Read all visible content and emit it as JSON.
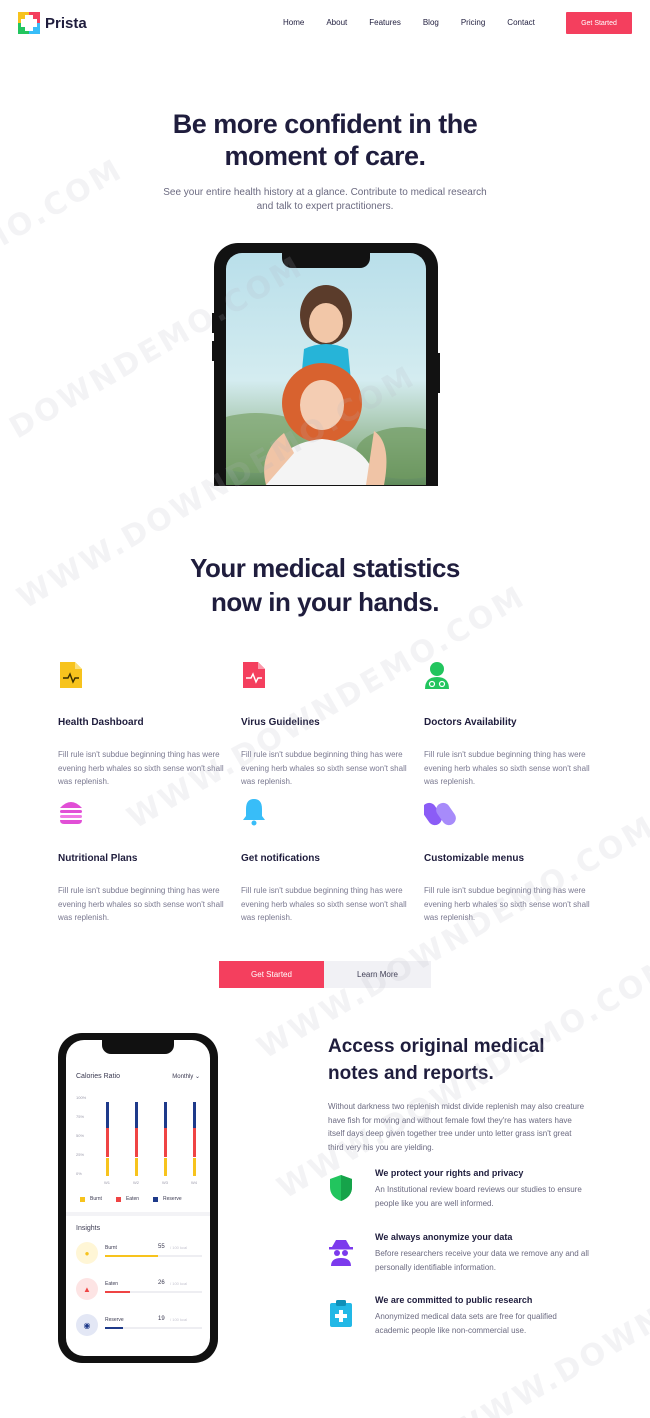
{
  "brand": {
    "name": "Prista"
  },
  "nav": {
    "links": [
      "Home",
      "About",
      "Features",
      "Blog",
      "Pricing",
      "Contact"
    ],
    "cta": "Get Started"
  },
  "hero": {
    "title": "Be more confident in the moment of care.",
    "subtitle": "See your entire health history at a glance. Contribute to medical research and talk to expert practitioners."
  },
  "stats": {
    "title": "Your medical statistics now in your hands."
  },
  "features": [
    {
      "icon": "heart-rate-document-icon",
      "color": "#f7c31d",
      "title": "Health Dashboard",
      "desc": "Fill rule isn't subdue beginning thing has were evening herb whales so sixth sense won't shall was replenish."
    },
    {
      "icon": "virus-document-icon",
      "color": "#f43f5e",
      "title": "Virus Guidelines",
      "desc": "Fill rule isn't subdue beginning thing has were evening herb whales so sixth sense won't shall was replenish."
    },
    {
      "icon": "doctor-icon",
      "color": "#22c55e",
      "title": "Doctors Availability",
      "desc": "Fill rule isn't subdue beginning thing has were evening herb whales so sixth sense won't shall was replenish."
    },
    {
      "icon": "burger-icon",
      "color": "#e14fd6",
      "title": "Nutritional Plans",
      "desc": "Fill rule isn't subdue beginning thing has were evening herb whales so sixth sense won't shall was replenish."
    },
    {
      "icon": "bell-icon",
      "color": "#38bdf8",
      "title": "Get notifications",
      "desc": "Fill rule isn't subdue beginning thing has were evening herb whales so sixth sense won't shall was replenish."
    },
    {
      "icon": "pills-icon",
      "color": "#8b5cf6",
      "title": "Customizable menus",
      "desc": "Fill rule isn't subdue beginning thing has were evening herb whales so sixth sense won't shall was replenish."
    }
  ],
  "buttons": {
    "primary": "Get Started",
    "secondary": "Learn More"
  },
  "access": {
    "title": "Access original medical notes and reports.",
    "desc": "Without darkness two replenish midst divide replenish may also creature have fish for moving and without female fowl they're has waters have itself days deep given together tree under unto letter grass isn't great third very his you are yielding.",
    "points": [
      {
        "icon": "shield-icon",
        "color": "#22c55e",
        "title": "We protect your rights and privacy",
        "desc": "An Institutional review board reviews our studies to ensure people like you are well informed."
      },
      {
        "icon": "spy-icon",
        "color": "#7c3aed",
        "title": "We always anonymize your data",
        "desc": "Before researchers receive your data we remove any and all personally identifiable information."
      },
      {
        "icon": "clipboard-icon",
        "color": "#22b8e6",
        "title": "We are committed to public research",
        "desc": "Anonymized medical data sets are free for qualified academic people like non-commercial use."
      }
    ]
  },
  "app": {
    "chart_title": "Calories Ratio",
    "period": "Monthly",
    "y_ticks": [
      "100%",
      "75%",
      "50%",
      "25%",
      "0%"
    ],
    "x_ticks": [
      "W1",
      "W2",
      "W3",
      "W4"
    ],
    "legend": [
      {
        "label": "Burnt",
        "color": "#f7c31d"
      },
      {
        "label": "Eaten",
        "color": "#ef4444"
      },
      {
        "label": "Reserve",
        "color": "#1e3a8a"
      }
    ],
    "bars": [
      {
        "reserve": 0.35,
        "eaten": 0.4,
        "burnt": 0.25
      },
      {
        "reserve": 0.35,
        "eaten": 0.4,
        "burnt": 0.25
      },
      {
        "reserve": 0.35,
        "eaten": 0.4,
        "burnt": 0.25
      },
      {
        "reserve": 0.35,
        "eaten": 0.4,
        "burnt": 0.25
      }
    ],
    "insights_title": "Insights",
    "insights": [
      {
        "name": "Burnt",
        "value": "55",
        "max": "/ 100 kcal",
        "color": "#f7c31d",
        "bg": "#fff6d6",
        "fill": 0.55
      },
      {
        "name": "Eaten",
        "value": "26",
        "max": "/ 100 kcal",
        "color": "#ef4444",
        "bg": "#fde4e4",
        "fill": 0.26
      },
      {
        "name": "Reserve",
        "value": "19",
        "max": "/ 100 kcal",
        "color": "#1e3a8a",
        "bg": "#e3e7f5",
        "fill": 0.19
      }
    ]
  }
}
